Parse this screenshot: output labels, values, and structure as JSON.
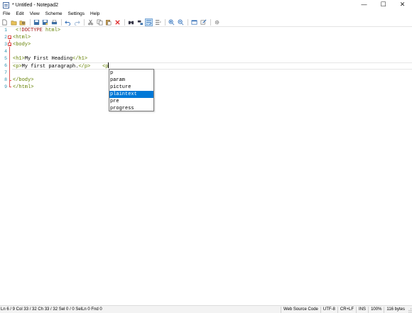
{
  "window": {
    "title": "* Untitled - Notepad2",
    "controls": {
      "minimize": "—",
      "maximize": "☐",
      "close": "✕"
    }
  },
  "menu": {
    "items": [
      "File",
      "Edit",
      "View",
      "Scheme",
      "Settings",
      "Help"
    ]
  },
  "toolbar": {
    "buttons": [
      "new-icon",
      "open-icon",
      "browse-icon",
      "save-icon",
      "save-as-icon",
      "print-icon",
      "undo-icon",
      "redo-icon",
      "cut-icon",
      "copy-icon",
      "paste-icon",
      "delete-icon",
      "find-icon",
      "replace-icon",
      "word-wrap-icon",
      "view-options-icon",
      "zoom-in-icon",
      "zoom-out-icon",
      "scheme-icon",
      "customize-icon",
      "settings-icon"
    ],
    "active_button": "word-wrap-icon"
  },
  "editor": {
    "lines": [
      {
        "num": "1",
        "text": "<!DOCTYPE html>"
      },
      {
        "num": "2",
        "text": "<html>"
      },
      {
        "num": "3",
        "text": "<body>"
      },
      {
        "num": "4",
        "text": ""
      },
      {
        "num": "5",
        "text": "<h1>My First Heading</h1>"
      },
      {
        "num": "6",
        "text": "<p>My first paragraph.</p>    <p"
      },
      {
        "num": "7",
        "text": ""
      },
      {
        "num": "8",
        "text": "</body>"
      },
      {
        "num": "9",
        "text": "</html>"
      }
    ],
    "current_line": 6
  },
  "autocomplete": {
    "items": [
      "p",
      "param",
      "picture",
      "plaintext",
      "pre",
      "progress"
    ],
    "selected": "plaintext"
  },
  "statusbar": {
    "position": "Ln 6 / 9  Col 33 / 32  Ch 33 / 32  Sel 0 / 0  SelLn 0  Fnd 0",
    "scheme": "Web Source Code",
    "encoding": "UTF-8",
    "line_ending": "CR+LF",
    "mode": "INS",
    "zoom": "100%",
    "size": "116 bytes"
  }
}
